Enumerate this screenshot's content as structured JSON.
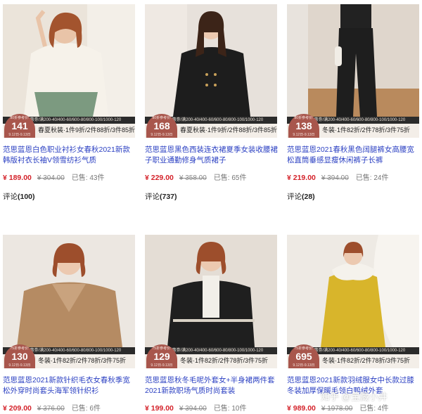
{
  "promo_banner": "10元优惠劵/满200-40/400-60/600-80/800-100/1000-120",
  "badge_label": "80折参考价:",
  "products": [
    {
      "badge_label": "80折参考价:",
      "badge_price": "141",
      "badge_date": "9.12日-9.13日",
      "promo": "春夏秋装·1件9折/2件88折/3件85折",
      "title": "范思蓝恩白色职业衬衫女春秋2021新款韩版衬衣长袖V领雪纺衫气质",
      "price": "¥ 189.00",
      "original": "¥ 304.00",
      "sold": "已售: 43件",
      "reviews_label": "评论",
      "reviews_count": "(100)",
      "colors": {
        "bg": "#ebe4da",
        "top": "#f6f2ea",
        "bottom": "#7c9a80"
      }
    },
    {
      "badge_label": "80折参考价:",
      "badge_price": "168",
      "badge_date": "9.12日-9.13日",
      "promo": "春夏秋装·1件9折/2件88折/3件85折",
      "title": "范思蓝恩黑色西装连衣裙夏季女装收腰裙子职业通勤修身气质裙子",
      "price": "¥ 229.00",
      "original": "¥ 358.00",
      "sold": "已售: 65件",
      "reviews_label": "评论",
      "reviews_count": "(737)",
      "colors": {
        "bg": "#e7e1db",
        "top": "#1d1d1d",
        "bottom": "#1d1d1d"
      }
    },
    {
      "badge_label": "80折参考价:",
      "badge_price": "138",
      "badge_date": "9.12日-9.13日",
      "promo": "冬装·1件82折/2件78折/3件75折",
      "title": "范思蓝恩2021春秋黑色阔腿裤女高腰宽松直筒垂感显瘦休闲裤子长裤",
      "price": "¥ 219.00",
      "original": "¥ 394.00",
      "sold": "已售: 24件",
      "reviews_label": "评论",
      "reviews_count": "(28)",
      "colors": {
        "bg": "#dfd6cc",
        "top": "#222222",
        "bottom": "#1e1e1e"
      }
    },
    {
      "badge_label": "75折参考价:",
      "badge_price": "130",
      "badge_date": "9.12日-9.13日",
      "promo": "冬装·1件82折/2件78折/3件75折",
      "title": "范思蓝恩2021新款针织毛衣女春秋季宽松外穿时尚套头海军领针织衫",
      "price": "¥ 209.00",
      "original": "¥ 376.00",
      "sold": "已售: 6件",
      "colors": {
        "bg": "#ece7e1",
        "top": "#b58b63",
        "bottom": "#b58b63"
      }
    },
    {
      "badge_label": "75折参考价:",
      "badge_price": "129",
      "badge_date": "9.12日-9.13日",
      "promo": "冬装·1件82折/2件78折/3件75折",
      "title": "范思蓝恩秋冬毛呢外套女+半身裙两件套2021新款职场气质时尚套装",
      "price": "¥ 199.00",
      "original": "¥ 394.00",
      "sold": "已售: 10件",
      "colors": {
        "bg": "#e4ddd5",
        "top": "#1f1f1f",
        "bottom": "#1f1f1f"
      }
    },
    {
      "badge_label": "75折参考价:",
      "badge_price": "695",
      "badge_date": "9.12日-9.13日",
      "promo": "冬装·1件82折/2件78折/3件75折",
      "title": "范思蓝恩2021新款羽绒服女中长款过膝冬装加厚保暖毛领白鸭绒外套",
      "price": "¥ 989.00",
      "original": "¥ 1978.00",
      "sold": "已售: 4件",
      "colors": {
        "bg": "#eeeae4",
        "top": "#d8b52b",
        "bottom": "#d8b52b"
      }
    }
  ],
  "watermark": "知乎 @宝藏小井"
}
